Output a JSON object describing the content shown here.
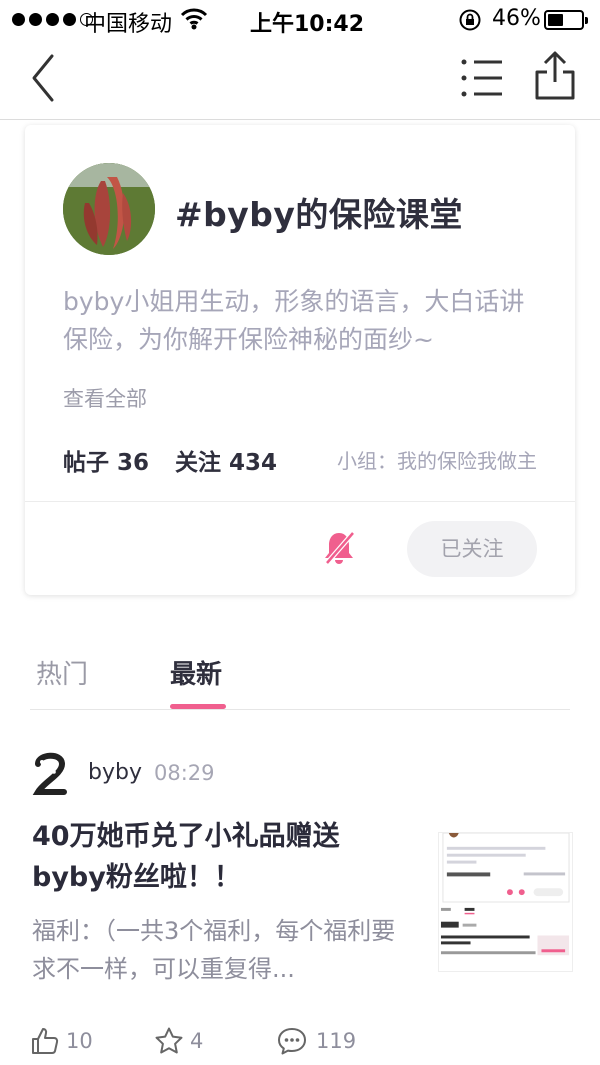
{
  "status_bar": {
    "carrier": "中国移动",
    "time": "上午10:42",
    "battery": "46%",
    "battery_level": 0.46
  },
  "nav": {
    "back_icon": "chevron-left-icon",
    "menu_icon": "list-menu-icon",
    "share_icon": "share-icon"
  },
  "topic": {
    "title": "#byby的保险课堂",
    "description": "byby小姐用生动，形象的语言，大白话讲保险，为你解开保险神秘的面纱~",
    "see_all": "查看全部",
    "posts": "帖子 36",
    "follows": "关注 434",
    "group": "小组：我的保险我做主",
    "follow_button": "已关注",
    "mute_icon": "bell-off-icon",
    "accent_color": "#f05f8e"
  },
  "tabs": [
    {
      "label": "热门",
      "active": false
    },
    {
      "label": "最新",
      "active": true
    }
  ],
  "post": {
    "author": "byby",
    "time": "08:29",
    "title": "40万她币兑了小礼品赠送byby粉丝啦！！",
    "excerpt": "福利：（一共3个福利，每个福利要求不一样，可以重复得...",
    "likes": "10",
    "favorites": "4",
    "comments": "119"
  }
}
